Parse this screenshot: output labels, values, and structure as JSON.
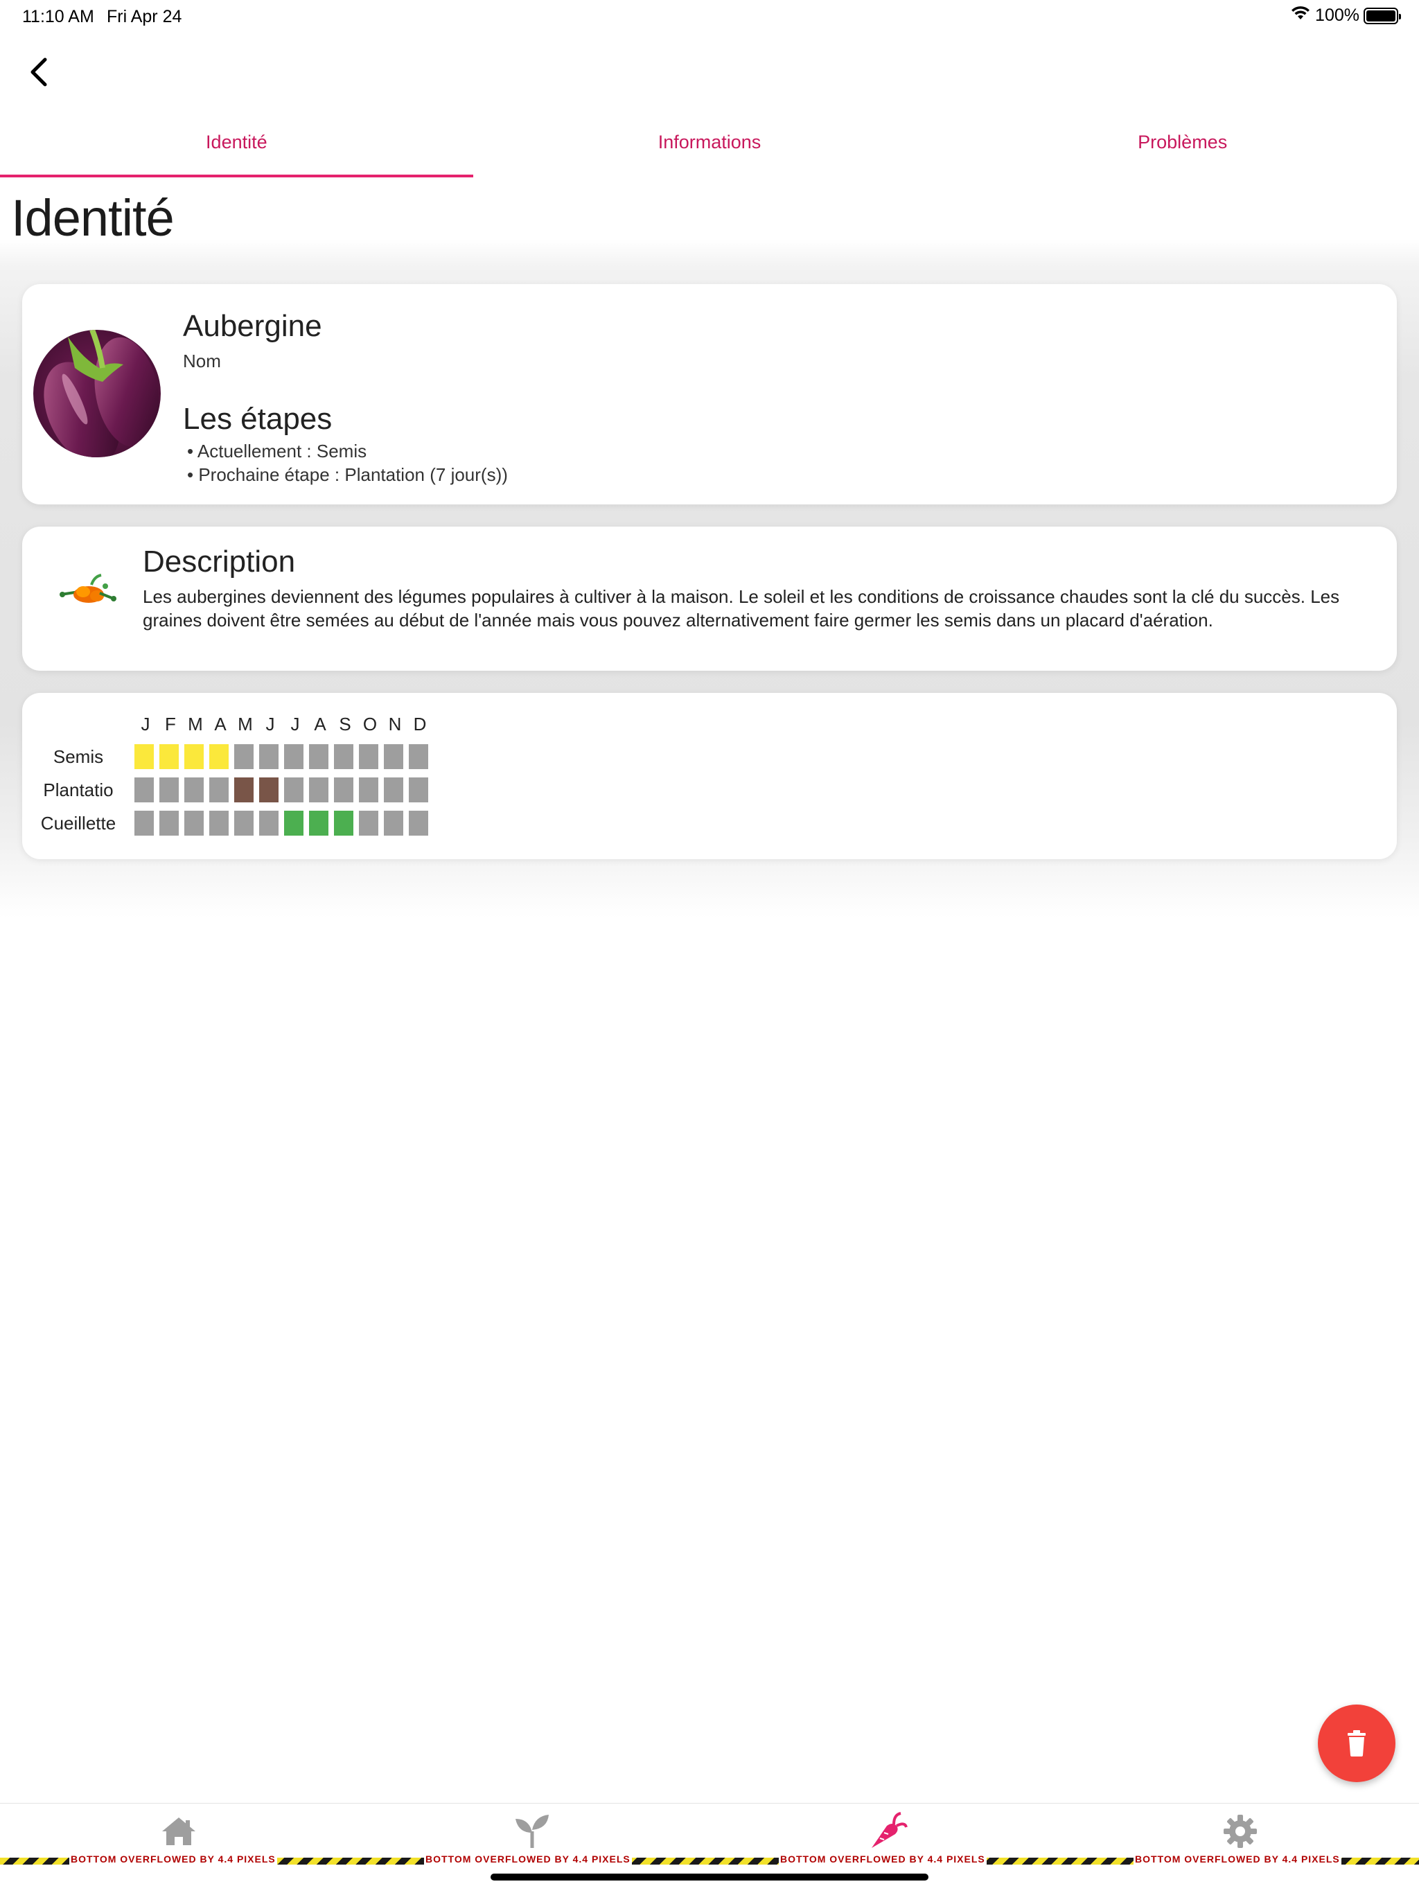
{
  "status_bar": {
    "time": "11:10 AM",
    "date": "Fri Apr 24",
    "battery": "100%"
  },
  "tabs": [
    {
      "label": "Identité",
      "active": true
    },
    {
      "label": "Informations",
      "active": false
    },
    {
      "label": "Problèmes",
      "active": false
    }
  ],
  "page_title": "Identité",
  "identity": {
    "name": "Aubergine",
    "name_caption": "Nom",
    "steps_title": "Les étapes",
    "current_step": "• Actuellement : Semis",
    "next_step": "• Prochaine étape : Plantation (7 jour(s))"
  },
  "description": {
    "title": "Description",
    "text": "Les aubergines deviennent des légumes populaires à cultiver à la maison. Le soleil et les conditions de croissance chaudes sont la clé du succès. Les graines doivent être semées au début de l'année mais vous pouvez alternativement faire germer les semis dans un placard d'aération."
  },
  "calendar": {
    "months": [
      "J",
      "F",
      "M",
      "A",
      "M",
      "J",
      "J",
      "A",
      "S",
      "O",
      "N",
      "D"
    ],
    "rows": [
      {
        "label": "Semis",
        "active_months": [
          1,
          2,
          3,
          4
        ],
        "color": "#fbe83b"
      },
      {
        "label": "Plantatio",
        "active_months": [
          5,
          6
        ],
        "color": "#795548"
      },
      {
        "label": "Cueillette",
        "active_months": [
          7,
          8,
          9
        ],
        "color": "#4caf50"
      }
    ],
    "inactive_color": "#9e9e9e"
  },
  "fab": {
    "icon": "trash-icon",
    "color": "#f2413a"
  },
  "bottom_nav": {
    "items": [
      {
        "icon": "home-icon",
        "active": false
      },
      {
        "icon": "sprout-icon",
        "active": false
      },
      {
        "icon": "carrot-icon",
        "active": true
      },
      {
        "icon": "gear-icon",
        "active": false
      }
    ],
    "overflow_text": "BOTTOM OVERFLOWED BY 4.4 PIXELS",
    "accent": "#e5226d",
    "inactive": "#9e9e9e"
  }
}
